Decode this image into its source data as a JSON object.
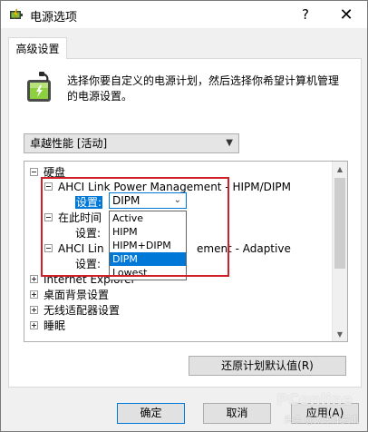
{
  "window": {
    "title": "电源选项",
    "help_glyph": "?",
    "close_glyph": "✕"
  },
  "tab": {
    "label": "高级设置"
  },
  "intro": {
    "text": "选择你要自定义的电源计划，然后选择你希望计算机管理的电源设置。"
  },
  "plan_select": {
    "value": "卓越性能 [活动]"
  },
  "tree": {
    "disk": "硬盘",
    "ahci_hipm": "AHCI Link Power Management - HIPM/DIPM",
    "setting_label": "设置:",
    "idle_after": "在此时间",
    "setting_label2": "设置:",
    "ahci_adaptive_left": "AHCI Lin",
    "ahci_adaptive_right": "ement - Adaptive",
    "setting_label3": "设置:",
    "ie": "Internet Explorer",
    "desktop_bg": "桌面背景设置",
    "wireless": "无线适配器设置",
    "sleep": "睡眠"
  },
  "combo": {
    "value": "DIPM",
    "options": [
      "Active",
      "HIPM",
      "HIPM+DIPM",
      "DIPM",
      "Lowest"
    ],
    "selected_index": 3
  },
  "buttons": {
    "restore": "还原计划默认值(R)",
    "ok": "确定",
    "cancel": "取消",
    "apply": "应用(A)"
  },
  "watermark": {
    "logo": "PConline",
    "caption": "头条 @太平洋资讯"
  },
  "colors": {
    "accent": "#0078d7",
    "annotation_red": "#d01f26"
  }
}
